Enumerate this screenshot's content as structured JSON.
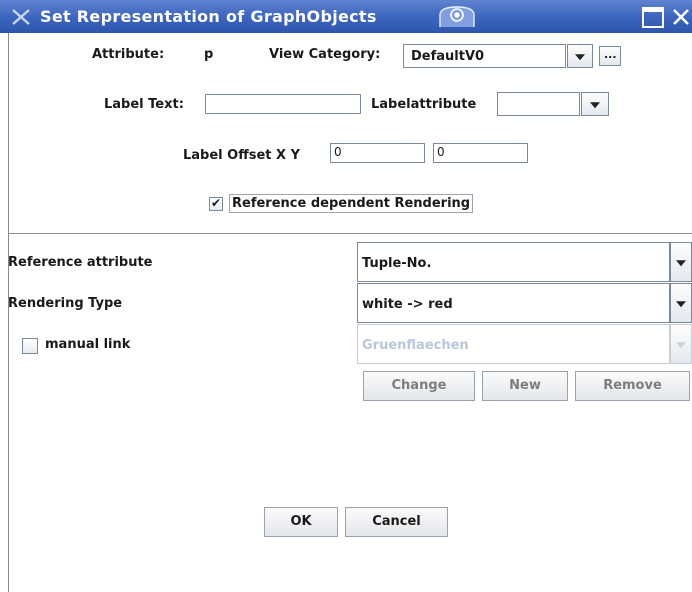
{
  "window": {
    "title": "Set Representation of GraphObjects"
  },
  "top": {
    "attribute_label": "Attribute:",
    "attribute_value": "p",
    "view_category_label": "View Category:",
    "view_category_value": "DefaultV0",
    "more_label": "...",
    "label_text_label": "Label Text:",
    "label_text_value": "",
    "labelattribute_label": "Labelattribute",
    "labelattribute_value": "",
    "label_offset_label": "Label Offset X Y",
    "offset_x": "0",
    "offset_y": "0",
    "ref_dependent_label": "Reference dependent Rendering",
    "ref_dependent_checked": true
  },
  "rows": {
    "reference_attribute_label": "Reference attribute",
    "reference_attribute_value": "Tuple-No.",
    "rendering_type_label": "Rendering Type",
    "rendering_type_value": "white -> red",
    "manual_link_label": "manual link",
    "manual_link_checked": false,
    "manual_link_value": "Gruenflaechen"
  },
  "buttons": {
    "change": "Change",
    "new": "New",
    "remove": "Remove",
    "ok": "OK",
    "cancel": "Cancel"
  },
  "colors": {
    "title_bar": "#3d66c0",
    "disabled_text": "#b8c8dc"
  }
}
